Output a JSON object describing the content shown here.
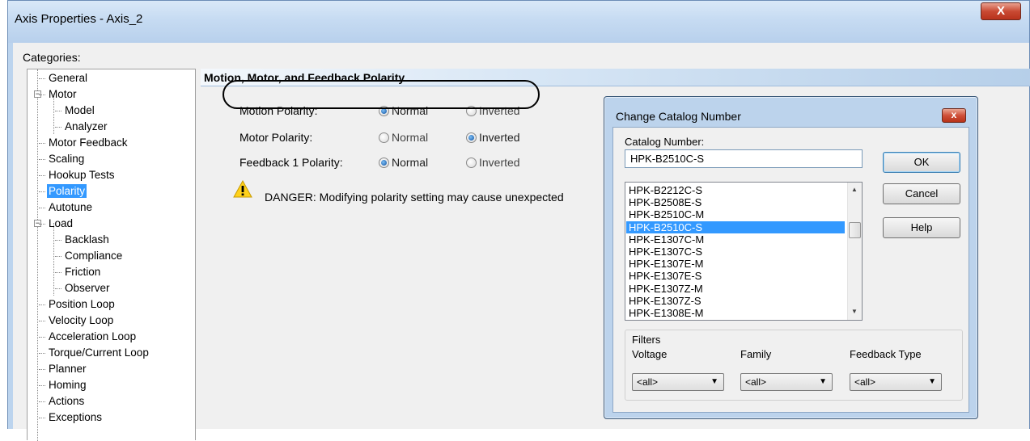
{
  "window": {
    "title": "Axis Properties - Axis_2",
    "close_label": "X"
  },
  "categories": {
    "label": "Categories:",
    "items": [
      {
        "label": "General"
      },
      {
        "label": "Motor"
      },
      {
        "label": "Model"
      },
      {
        "label": "Analyzer"
      },
      {
        "label": "Motor Feedback"
      },
      {
        "label": "Scaling"
      },
      {
        "label": "Hookup Tests"
      },
      {
        "label": "Polarity"
      },
      {
        "label": "Autotune"
      },
      {
        "label": "Load"
      },
      {
        "label": "Backlash"
      },
      {
        "label": "Compliance"
      },
      {
        "label": "Friction"
      },
      {
        "label": "Observer"
      },
      {
        "label": "Position Loop"
      },
      {
        "label": "Velocity Loop"
      },
      {
        "label": "Acceleration Loop"
      },
      {
        "label": "Torque/Current Loop"
      },
      {
        "label": "Planner"
      },
      {
        "label": "Homing"
      },
      {
        "label": "Actions"
      },
      {
        "label": "Exceptions"
      }
    ],
    "selected": "Polarity"
  },
  "polarity": {
    "header": "Motion, Motor, and Feedback Polarity",
    "rows": [
      {
        "label": "Motion Polarity:",
        "normal": "Normal",
        "inverted": "Inverted",
        "value": "Normal"
      },
      {
        "label": "Motor Polarity:",
        "normal": "Normal",
        "inverted": "Inverted",
        "value": "Inverted"
      },
      {
        "label": "Feedback 1 Polarity:",
        "normal": "Normal",
        "inverted": "Inverted",
        "value": "Normal"
      }
    ],
    "danger_text": "DANGER: Modifying polarity setting may cause unexpected"
  },
  "dialog": {
    "title": "Change Catalog Number",
    "close_label": "x",
    "catalog_label": "Catalog Number:",
    "catalog_value": "HPK-B2510C-S",
    "ok": "OK",
    "cancel": "Cancel",
    "help": "Help",
    "list": [
      "HPK-B2212C-S",
      "HPK-B2508E-S",
      "HPK-B2510C-M",
      "HPK-B2510C-S",
      "HPK-E1307C-M",
      "HPK-E1307C-S",
      "HPK-E1307E-M",
      "HPK-E1307E-S",
      "HPK-E1307Z-M",
      "HPK-E1307Z-S",
      "HPK-E1308E-M"
    ],
    "selected_index": 3,
    "filters": {
      "label": "Filters",
      "voltage_label": "Voltage",
      "voltage_value": "<all>",
      "family_label": "Family",
      "family_value": "<all>",
      "feedback_label": "Feedback Type",
      "feedback_value": "<all>"
    }
  },
  "colors": {
    "selection": "#3399ff",
    "window_frame": "#bcd4ee",
    "client_bg": "#f0f0f0"
  }
}
